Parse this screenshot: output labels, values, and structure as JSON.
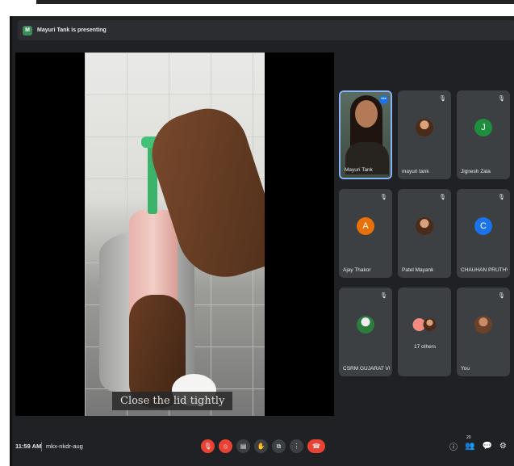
{
  "presenting_bar": {
    "badge": "M",
    "text": "Mayuri Tank is presenting"
  },
  "stage": {
    "caption": "Close the lid tightly"
  },
  "participants": [
    {
      "name": "Mayuri Tank",
      "kind": "camera",
      "active": true,
      "mic": "",
      "more": "•••"
    },
    {
      "name": "mayuri tank",
      "kind": "photo",
      "mic": "🎙"
    },
    {
      "name": "Jignesh Zala",
      "kind": "letter",
      "letter": "J",
      "color": "#1e8e3e",
      "mic": "🎙"
    },
    {
      "name": "Ajay Thakor",
      "kind": "letter",
      "letter": "A",
      "color": "#e8710a",
      "mic": "🎙"
    },
    {
      "name": "Patel Mayank",
      "kind": "photo",
      "mic": "🎙"
    },
    {
      "name": "CHAUHAN PRUTHVI...",
      "kind": "letter",
      "letter": "C",
      "color": "#1a73e8",
      "mic": "🎙"
    },
    {
      "name": "CSRM GUJARAT VID...",
      "kind": "green",
      "mic": "🎙"
    },
    {
      "name": "17 others",
      "kind": "pair",
      "mic": ""
    },
    {
      "name": "You",
      "kind": "self",
      "mic": "🎙"
    }
  ],
  "bottombar": {
    "time": "11:59 AM",
    "meeting_code": "mkx-nkdr-aug",
    "controls": [
      "🎙",
      "⦸",
      "▤",
      "✋",
      "⧉",
      "⋮",
      "☎"
    ],
    "people_count": "20",
    "right_icons": [
      "ⓘ",
      "👥",
      "💬",
      "⚙"
    ]
  }
}
